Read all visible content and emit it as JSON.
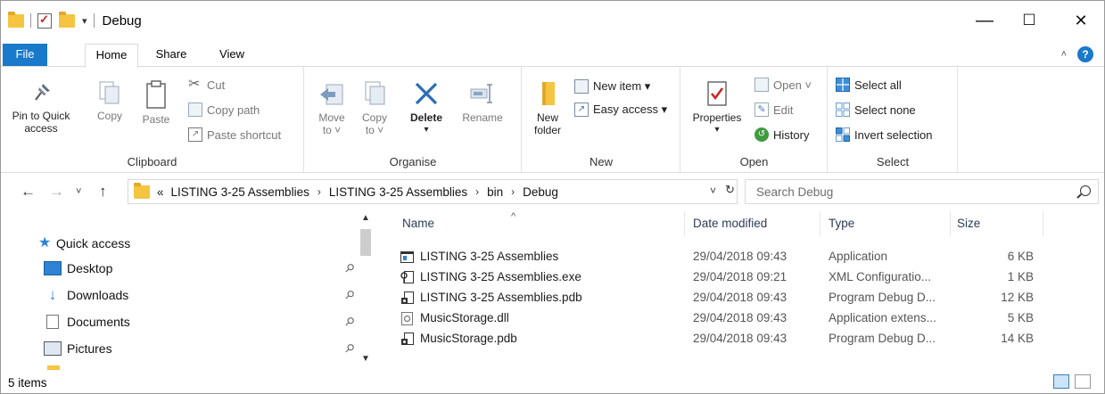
{
  "window": {
    "title": "Debug",
    "controls": {
      "minimize": "—",
      "maximize": "☐",
      "close": "✕"
    }
  },
  "ribbon": {
    "tabs": [
      "File",
      "Home",
      "Share",
      "View"
    ],
    "clipboard": {
      "label": "Clipboard",
      "pin_line1": "Pin to Quick",
      "pin_line2": "access",
      "copy": "Copy",
      "paste": "Paste",
      "cut": "Cut",
      "copy_path": "Copy path",
      "paste_shortcut": "Paste shortcut"
    },
    "organise": {
      "label": "Organise",
      "move_line1": "Move",
      "move_line2": "to ˅",
      "copy_line1": "Copy",
      "copy_line2": "to ˅",
      "delete": "Delete",
      "delete_caret": "▾",
      "rename": "Rename"
    },
    "new": {
      "label": "New",
      "folder_line1": "New",
      "folder_line2": "folder",
      "new_item": "New item ▾",
      "easy_access": "Easy access ▾"
    },
    "open": {
      "label": "Open",
      "properties": "Properties",
      "properties_caret": "▾",
      "open": "Open ˅",
      "edit": "Edit",
      "history": "History"
    },
    "select": {
      "label": "Select",
      "select_all": "Select all",
      "select_none": "Select none",
      "invert_selection": "Invert selection"
    }
  },
  "address": {
    "overflow": "«",
    "crumbs": [
      "LISTING 3-25 Assemblies",
      "LISTING 3-25 Assemblies",
      "bin",
      "Debug"
    ],
    "search_placeholder": "Search Debug"
  },
  "nav": {
    "items": [
      "Quick access",
      "Desktop",
      "Downloads",
      "Documents",
      "Pictures"
    ]
  },
  "list": {
    "columns": [
      "Name",
      "Date modified",
      "Type",
      "Size"
    ],
    "files": [
      {
        "name": "LISTING 3-25 Assemblies",
        "date": "29/04/2018 09:43",
        "type": "Application",
        "size": "6 KB",
        "icon": "application-icon"
      },
      {
        "name": "LISTING 3-25 Assemblies.exe",
        "date": "29/04/2018 09:21",
        "type": "XML Configuratio...",
        "size": "1 KB",
        "icon": "config-file-icon"
      },
      {
        "name": "LISTING 3-25 Assemblies.pdb",
        "date": "29/04/2018 09:43",
        "type": "Program Debug D...",
        "size": "12 KB",
        "icon": "pdb-file-icon"
      },
      {
        "name": "MusicStorage.dll",
        "date": "29/04/2018 09:43",
        "type": "Application extens...",
        "size": "5 KB",
        "icon": "dll-file-icon"
      },
      {
        "name": "MusicStorage.pdb",
        "date": "29/04/2018 09:43",
        "type": "Program Debug D...",
        "size": "14 KB",
        "icon": "pdb-file-icon"
      }
    ]
  },
  "status": {
    "text": "5 items"
  },
  "colors": {
    "accent": "#1979ca",
    "folder": "#f5c542",
    "header_text": "#2b3d57"
  }
}
